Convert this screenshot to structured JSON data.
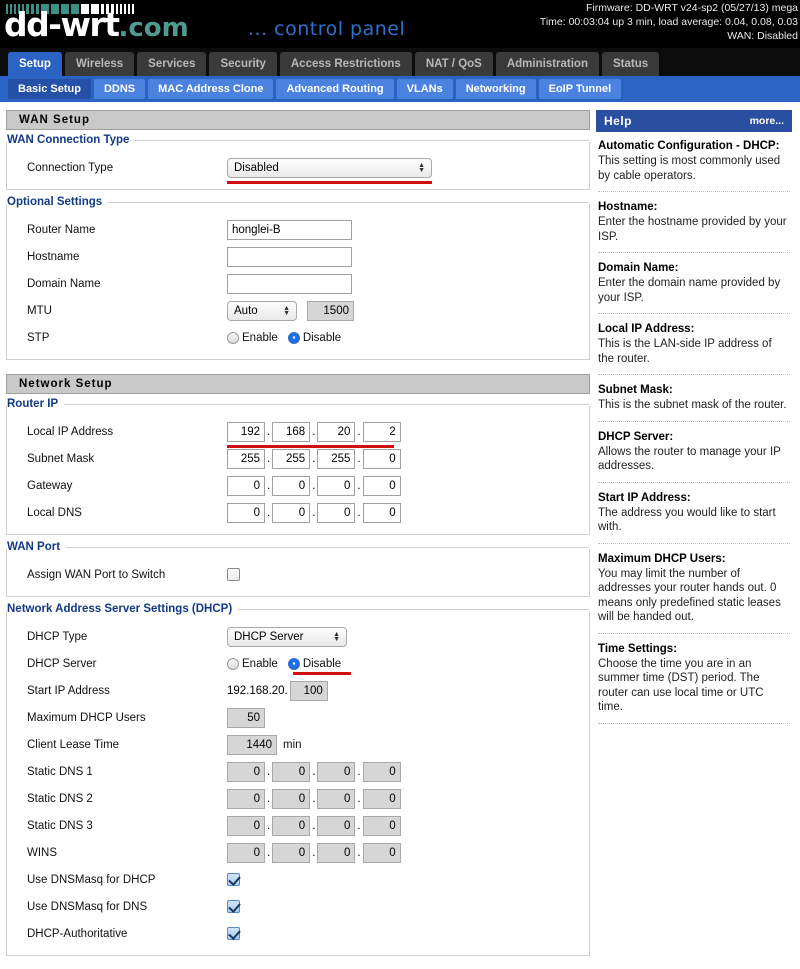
{
  "header": {
    "brand_main": "dd-wrt",
    "brand_suffix": ".com",
    "panel_title": "... control panel",
    "firmware": "Firmware: DD-WRT v24-sp2 (05/27/13) mega",
    "time": "Time: 00:03:04 up 3 min, load average: 0.04, 0.08, 0.03",
    "wan": "WAN: Disabled"
  },
  "primary_tabs": [
    {
      "label": "Setup",
      "active": true
    },
    {
      "label": "Wireless",
      "active": false
    },
    {
      "label": "Services",
      "active": false
    },
    {
      "label": "Security",
      "active": false
    },
    {
      "label": "Access Restrictions",
      "active": false
    },
    {
      "label": "NAT / QoS",
      "active": false
    },
    {
      "label": "Administration",
      "active": false
    },
    {
      "label": "Status",
      "active": false
    }
  ],
  "secondary_tabs": [
    {
      "label": "Basic Setup",
      "active": true
    },
    {
      "label": "DDNS",
      "active": false
    },
    {
      "label": "MAC Address Clone",
      "active": false
    },
    {
      "label": "Advanced Routing",
      "active": false
    },
    {
      "label": "VLANs",
      "active": false
    },
    {
      "label": "Networking",
      "active": false
    },
    {
      "label": "EoIP Tunnel",
      "active": false
    }
  ],
  "wan_setup": {
    "section_title": "WAN Setup",
    "connection_group": "WAN Connection Type",
    "connection_label": "Connection Type",
    "connection_value": "Disabled",
    "optional_group": "Optional Settings",
    "router_name_label": "Router Name",
    "router_name_value": "honglei-B",
    "hostname_label": "Hostname",
    "hostname_value": "",
    "domain_label": "Domain Name",
    "domain_value": "",
    "mtu_label": "MTU",
    "mtu_mode": "Auto",
    "mtu_value": "1500",
    "stp_label": "STP",
    "stp_enable": "Enable",
    "stp_disable": "Disable",
    "stp_selected": "Disable"
  },
  "network_setup": {
    "section_title": "Network Setup",
    "router_ip_group": "Router IP",
    "local_ip_label": "Local IP Address",
    "local_ip": [
      "192",
      "168",
      "20",
      "2"
    ],
    "subnet_label": "Subnet Mask",
    "subnet": [
      "255",
      "255",
      "255",
      "0"
    ],
    "gateway_label": "Gateway",
    "gateway": [
      "0",
      "0",
      "0",
      "0"
    ],
    "local_dns_label": "Local DNS",
    "local_dns": [
      "0",
      "0",
      "0",
      "0"
    ],
    "wan_port_group": "WAN Port",
    "assign_wan_label": "Assign WAN Port to Switch",
    "assign_wan_checked": false
  },
  "dhcp": {
    "group": "Network Address Server Settings (DHCP)",
    "type_label": "DHCP Type",
    "type_value": "DHCP Server",
    "server_label": "DHCP Server",
    "server_enable": "Enable",
    "server_disable": "Disable",
    "server_selected": "Disable",
    "start_ip_label": "Start IP Address",
    "start_ip_prefix": "192.168.20.",
    "start_ip_value": "100",
    "max_users_label": "Maximum DHCP Users",
    "max_users_value": "50",
    "lease_label": "Client Lease Time",
    "lease_value": "1440",
    "lease_unit": "min",
    "static_dns_1_label": "Static DNS 1",
    "static_dns_1": [
      "0",
      "0",
      "0",
      "0"
    ],
    "static_dns_2_label": "Static DNS 2",
    "static_dns_2": [
      "0",
      "0",
      "0",
      "0"
    ],
    "static_dns_3_label": "Static DNS 3",
    "static_dns_3": [
      "0",
      "0",
      "0",
      "0"
    ],
    "wins_label": "WINS",
    "wins": [
      "0",
      "0",
      "0",
      "0"
    ],
    "dnsmasq_dhcp_label": "Use DNSMasq for DHCP",
    "dnsmasq_dhcp_checked": true,
    "dnsmasq_dns_label": "Use DNSMasq for DNS",
    "dnsmasq_dns_checked": true,
    "authoritative_label": "DHCP-Authoritative",
    "authoritative_checked": true
  },
  "help": {
    "title": "Help",
    "more": "more...",
    "items": [
      {
        "title": "Automatic Configuration - DHCP:",
        "text": "This setting is most commonly used by cable operators."
      },
      {
        "title": "Hostname:",
        "text": "Enter the hostname provided by your ISP."
      },
      {
        "title": "Domain Name:",
        "text": "Enter the domain name provided by your ISP."
      },
      {
        "title": "Local IP Address:",
        "text": "This is the LAN-side IP address of the router."
      },
      {
        "title": "Subnet Mask:",
        "text": "This is the subnet mask of the router."
      },
      {
        "title": "DHCP Server:",
        "text": "Allows the router to manage your IP addresses."
      },
      {
        "title": "Start IP Address:",
        "text": "The address you would like to start with."
      },
      {
        "title": "Maximum DHCP Users:",
        "text": "You may limit the number of addresses your router hands out. 0 means only predefined static leases will be handed out."
      },
      {
        "title": "Time Settings:",
        "text": "Choose the time you are in an summer time (DST) period. The router can use local time or UTC time."
      }
    ]
  },
  "colors": {
    "accent_blue": "#2a63c4",
    "help_header": "#2a4fa0",
    "annotation_red": "#d10f0f",
    "brand_teal": "#4f9b92"
  }
}
